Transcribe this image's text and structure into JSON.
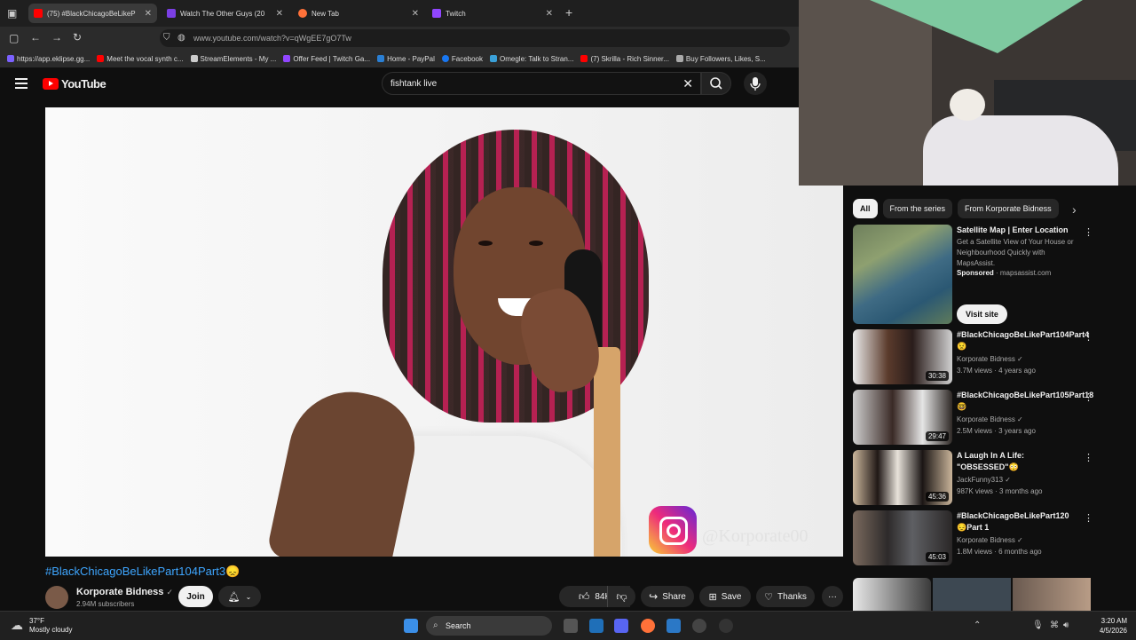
{
  "browser": {
    "tabs": [
      {
        "label": "(75) #BlackChicagoBeLikeP",
        "active": true
      },
      {
        "label": "Watch The Other Guys (20",
        "active": false
      },
      {
        "label": "New Tab",
        "active": false
      },
      {
        "label": "Twitch",
        "active": false
      }
    ],
    "new_tab_symbol": "+",
    "url": "www.youtube.com/watch?v=qWgEE7gO7Tw",
    "bookmarks": [
      "https://app.eklipse.gg...",
      "Meet the vocal synth c...",
      "StreamElements - My ...",
      "Offer Feed | Twitch Ga...",
      "Home - PayPal",
      "Facebook",
      "Omegle: Talk to Stran...",
      "(7) Skrilla - Rich Sinner...",
      "Buy Followers, Likes, S..."
    ]
  },
  "youtube": {
    "logo_text": "YouTube",
    "search_value": "fishtank live",
    "clear_symbol": "✕"
  },
  "video": {
    "watermark": "@Korporate00",
    "title": "#BlackChicagoBeLikePart104Part3😞",
    "channel": "Korporate Bidness",
    "verified": "✓",
    "subscribers": "2.94M subscribers",
    "join_label": "Join",
    "likes": "84K",
    "share_label": "Share",
    "save_label": "Save",
    "thanks_label": "Thanks",
    "more_symbol": "···"
  },
  "sidebar": {
    "chips": [
      "All",
      "From the series",
      "From Korporate Bidness"
    ],
    "chip_next": "›",
    "items": [
      {
        "title": "Satellite Map | Enter Location",
        "desc": "Get a Satellite View of Your House or Neighbourhood Quickly with MapsAssist.",
        "sponsored": "Sponsored",
        "domain": " · mapsassist.com",
        "button": "Visit site"
      },
      {
        "title": "#BlackChicagoBeLikePart104Part4😟",
        "channel": "Korporate Bidness ✓",
        "meta": "3.7M views · 4 years ago",
        "duration": "30:38"
      },
      {
        "title": "#BlackChicagoBeLikePart105Part18🤓",
        "channel": "Korporate Bidness ✓",
        "meta": "2.5M views · 3 years ago",
        "duration": "29:47"
      },
      {
        "title": "A Laugh In A Life: \"OBSESSED\"😳",
        "channel": "JackFunny313 ✓",
        "meta": "987K views · 3 months ago",
        "duration": "45:36"
      },
      {
        "title": "#BlackChicagoBeLikePart120😔Part 1",
        "channel": "Korporate Bidness ✓",
        "meta": "1.8M views · 6 months ago",
        "duration": "45:03"
      }
    ]
  },
  "taskbar": {
    "temp": "37°F",
    "weather": "Mostly cloudy",
    "search_label": "Search",
    "time": "3:20 AM",
    "date": "4/5/2026"
  },
  "colors": {
    "link_blue": "#3ea6ff",
    "yt_red": "#ff0000",
    "bg": "#0f0f0f"
  }
}
